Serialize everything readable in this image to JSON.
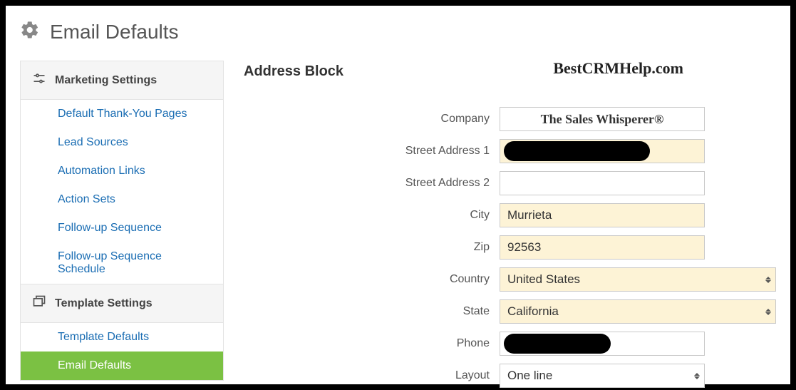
{
  "pageTitle": "Email Defaults",
  "watermark": "BestCRMHelp.com",
  "sidebar": {
    "sections": [
      {
        "title": "Marketing Settings",
        "items": [
          {
            "label": "Default Thank-You Pages",
            "selected": false
          },
          {
            "label": "Lead Sources",
            "selected": false
          },
          {
            "label": "Automation Links",
            "selected": false
          },
          {
            "label": "Action Sets",
            "selected": false
          },
          {
            "label": "Follow-up Sequence",
            "selected": false
          },
          {
            "label": "Follow-up Sequence Schedule",
            "selected": false
          }
        ]
      },
      {
        "title": "Template Settings",
        "items": [
          {
            "label": "Template Defaults",
            "selected": false
          },
          {
            "label": "Email Defaults",
            "selected": true
          }
        ]
      }
    ]
  },
  "main": {
    "heading": "Address Block",
    "fields": {
      "company": {
        "label": "Company",
        "value": "The Sales Whisperer®"
      },
      "street1": {
        "label": "Street Address 1",
        "value": ""
      },
      "street2": {
        "label": "Street Address 2",
        "value": ""
      },
      "city": {
        "label": "City",
        "value": "Murrieta"
      },
      "zip": {
        "label": "Zip",
        "value": "92563"
      },
      "country": {
        "label": "Country",
        "value": "United States"
      },
      "state": {
        "label": "State",
        "value": "California"
      },
      "phone": {
        "label": "Phone",
        "value": ""
      },
      "layout": {
        "label": "Layout",
        "value": "One line"
      }
    }
  }
}
